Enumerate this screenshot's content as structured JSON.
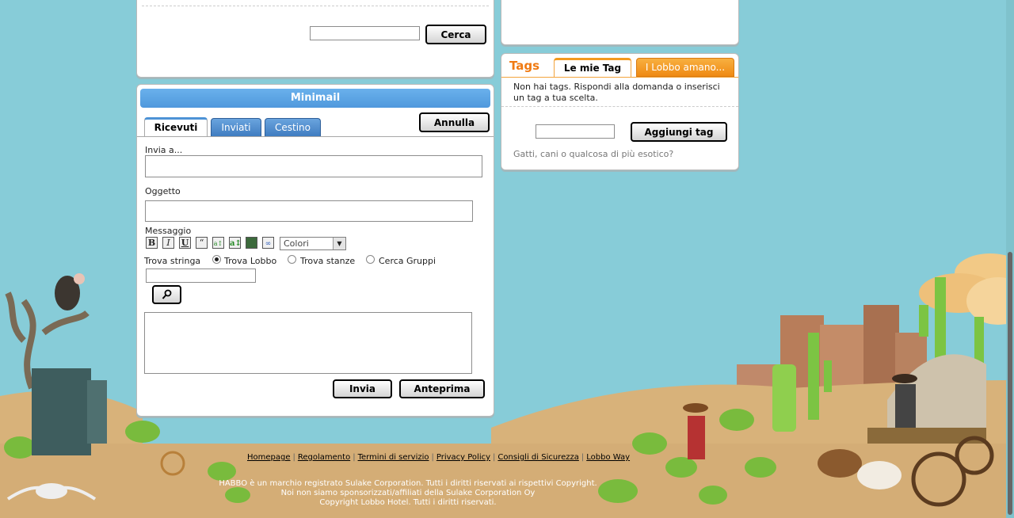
{
  "search": {
    "button": "Cerca"
  },
  "minimail": {
    "title": "Minimail",
    "tabs": [
      {
        "label": "Ricevuti",
        "active": true
      },
      {
        "label": "Inviati",
        "active": false
      },
      {
        "label": "Cestino",
        "active": false
      }
    ],
    "cancel_button": "Annulla",
    "to_label": "Invia a...",
    "subject_label": "Oggetto",
    "message_label": "Messaggio",
    "toolbar": {
      "bold": "B",
      "italic": "I",
      "underline": "U",
      "quote": "“",
      "colors_select": "Colori"
    },
    "find_label": "Trova stringa",
    "radios": [
      {
        "label": "Trova Lobbo",
        "checked": true
      },
      {
        "label": "Trova stanze",
        "checked": false
      },
      {
        "label": "Cerca Gruppi",
        "checked": false
      }
    ],
    "send_button": "Invia",
    "preview_button": "Anteprima"
  },
  "tags": {
    "title": "Tags",
    "tabs": [
      {
        "label": "Le mie Tag",
        "active": true
      },
      {
        "label": "I Lobbo amano...",
        "active": false
      }
    ],
    "empty_text_line1": "Non hai tags. Rispondi alla domanda o inserisci",
    "empty_text_line2": "un tag a tua scelta.",
    "add_button": "Aggiungi tag",
    "question": "Gatti, cani o qualcosa di più esotico?"
  },
  "footer": {
    "links": [
      "Homepage",
      "Regolamento",
      "Termini di servizio",
      "Privacy Policy",
      "Consigli di Sicurezza",
      "Lobbo Way"
    ],
    "line1": "HABBO è un marchio registrato Sulake Corporation. Tutti i diritti riservati ai rispettivi Copyright.",
    "line2": "Noi non siamo sponsorizzati/affiliati della Sulake Corporation Oy",
    "line3": "Copyright Lobbo Hotel. Tutti i diritti riservati."
  },
  "colors": {
    "sky": "#87ccd8",
    "header_blue": "#5aa1e0",
    "tags_orange": "#f07a12",
    "tag_tab_orange": "#f39a1e"
  }
}
